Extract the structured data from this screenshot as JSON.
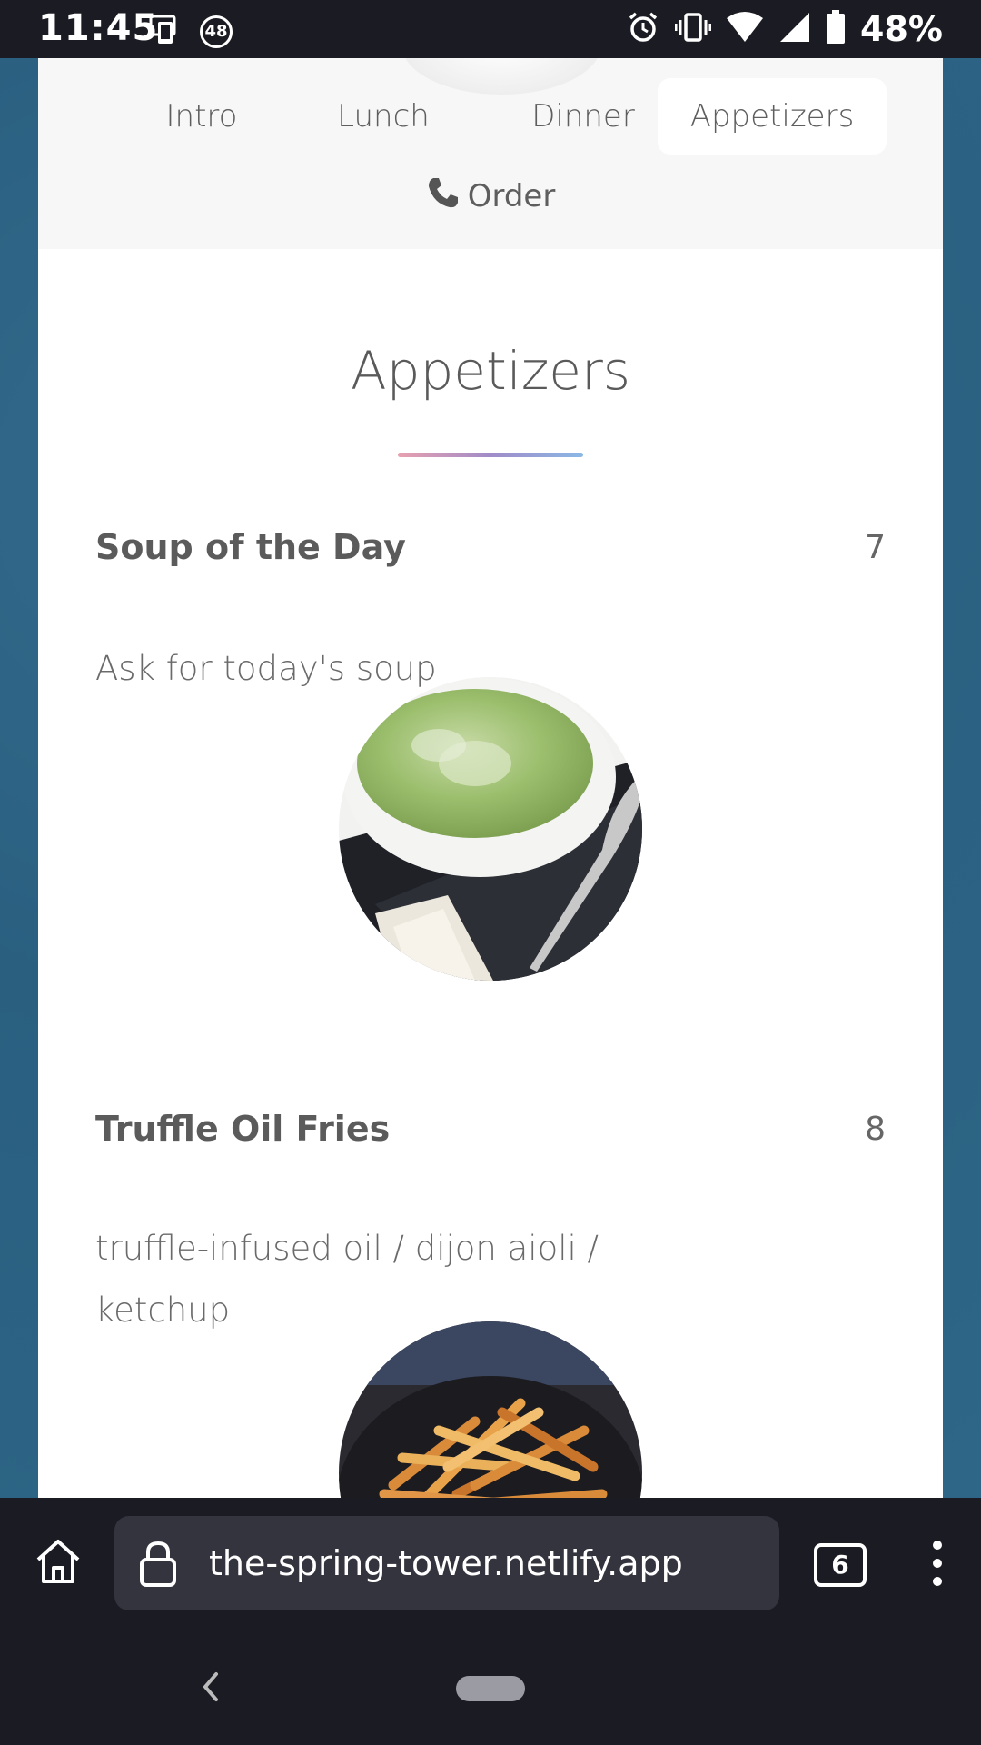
{
  "status_bar": {
    "time": "11:45",
    "notification_count": "48",
    "battery_percent": "48%"
  },
  "nav": {
    "items": [
      {
        "label": "Intro"
      },
      {
        "label": "Lunch"
      },
      {
        "label": "Dinner"
      },
      {
        "label": "Appetizers",
        "active": true
      }
    ],
    "order_label": "Order"
  },
  "section": {
    "title": "Appetizers",
    "divider_colors": [
      "#e8a0b0",
      "#a08cc8",
      "#8ab8e6"
    ]
  },
  "menu_items": [
    {
      "name": "Soup of the Day",
      "price": "7",
      "description": "Ask for today's soup",
      "photo": "green-soup-bowl"
    },
    {
      "name": "Truffle Oil Fries",
      "price": "8",
      "description_lines": [
        "truffle-infused oil / dijon aioli /",
        "ketchup"
      ],
      "photo": "fries-plate"
    }
  ],
  "browser": {
    "url": "the-spring-tower.netlify.app",
    "tab_count": "6"
  },
  "colors": {
    "page_background": "#2c6384",
    "nav_background": "#f7f7f7",
    "text": "#5b5b5b",
    "browser_chrome": "#1b1b23"
  }
}
